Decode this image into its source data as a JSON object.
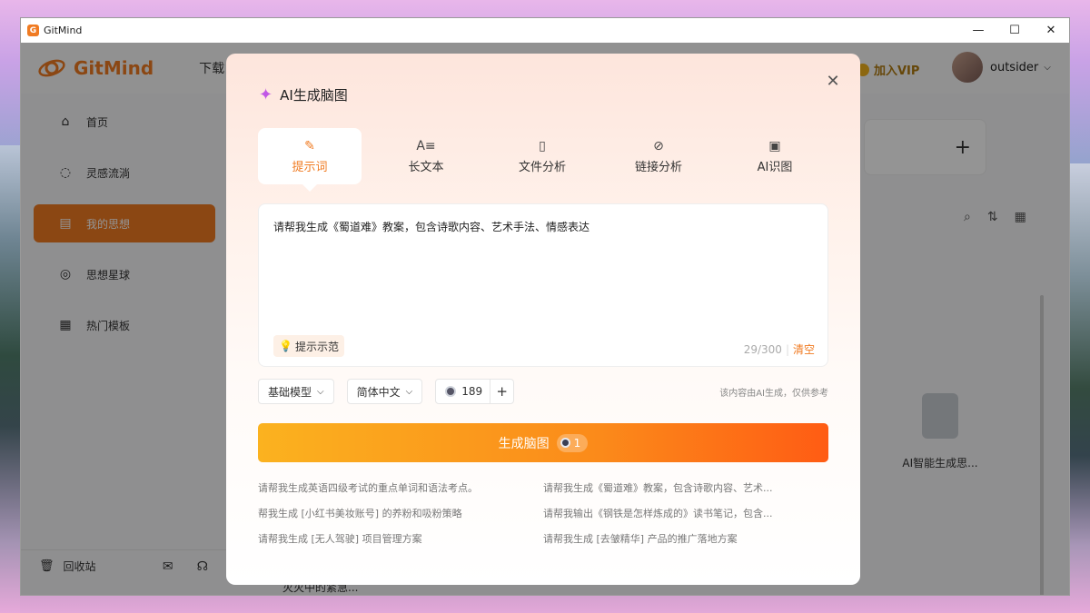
{
  "window": {
    "title": "GitMind",
    "controls": [
      "—",
      "☐",
      "✕"
    ]
  },
  "header": {
    "brand": "GitMind",
    "nav_download": "下载",
    "vip_label": "加入VIP",
    "username": "outsider"
  },
  "sidebar": {
    "items": [
      {
        "label": "首页",
        "icon": "home-icon"
      },
      {
        "label": "灵感流淌",
        "icon": "bulb-icon"
      },
      {
        "label": "我的思想",
        "icon": "document-icon",
        "active": true
      },
      {
        "label": "思想星球",
        "icon": "planet-icon"
      },
      {
        "label": "热门模板",
        "icon": "template-icon"
      }
    ],
    "trash_label": "回收站"
  },
  "main": {
    "file_name": "AI智能生成思...",
    "bottom_snippet": "灭灭中的紧急..."
  },
  "modal": {
    "title": "AI生成脑图",
    "tabs": [
      {
        "label": "提示词",
        "icon": "feather-icon",
        "active": true
      },
      {
        "label": "长文本",
        "icon": "long-text-icon"
      },
      {
        "label": "文件分析",
        "icon": "file-icon"
      },
      {
        "label": "链接分析",
        "icon": "link-icon"
      },
      {
        "label": "AI识图",
        "icon": "image-icon"
      }
    ],
    "prompt_text": "请帮我生成《蜀道难》教案，包含诗歌内容、艺术手法、情感表达",
    "example_label": "提示示范",
    "counter": "29/300",
    "clear_label": "清空",
    "model_select": "基础模型",
    "language_select": "简体中文",
    "credits": "189",
    "disclaimer": "该内容由AI生成，仅供参考",
    "generate_label": "生成脑图",
    "generate_cost": "1",
    "suggestions": [
      "请帮我生成英语四级考试的重点单词和语法考点。",
      "请帮我生成《蜀道难》教案，包含诗歌内容、艺术...",
      "帮我生成 [小红书美妆账号] 的养粉和吸粉策略",
      "请帮我输出《钢铁是怎样炼成的》读书笔记，包含...",
      "请帮我生成 [无人驾驶] 项目管理方案",
      "请帮我生成 [去皱精华] 产品的推广落地方案"
    ]
  },
  "colors": {
    "accent": "#f07b22",
    "gradient_start": "#fbb21f",
    "gradient_end": "#ff5c14"
  }
}
